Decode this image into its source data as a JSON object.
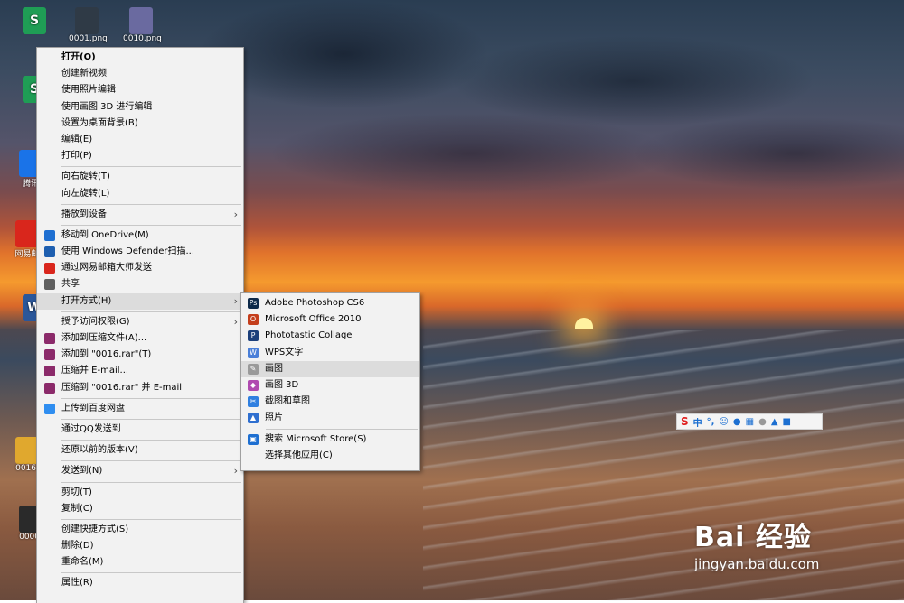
{
  "desktop": {
    "icons": [
      {
        "label": "",
        "glyph": "S",
        "color": "#1f9d55"
      },
      {
        "label": "0001.png",
        "glyph": "",
        "color": "#2f3a46"
      },
      {
        "label": "0010.png",
        "glyph": "",
        "color": "#6a6aa0"
      },
      {
        "label": "",
        "glyph": "S",
        "color": "#1f9d55"
      },
      {
        "label": "腾讯",
        "glyph": "",
        "color": "#1a73e8"
      },
      {
        "label": "网易邮",
        "glyph": "",
        "color": "#d9261c"
      },
      {
        "label": "",
        "glyph": "W",
        "color": "#2b579a"
      },
      {
        "label": "0016.",
        "glyph": "",
        "color": "#e0a82e"
      },
      {
        "label": "0000.",
        "glyph": "",
        "color": "#2a2a2a"
      }
    ]
  },
  "context_menu": {
    "items": [
      {
        "label": "打开(O)",
        "bold": true
      },
      {
        "label": "创建新视频"
      },
      {
        "label": "使用照片编辑"
      },
      {
        "label": "使用画图 3D 进行编辑"
      },
      {
        "label": "设置为桌面背景(B)"
      },
      {
        "label": "编辑(E)"
      },
      {
        "label": "打印(P)"
      },
      {
        "sep": true
      },
      {
        "label": "向右旋转(T)"
      },
      {
        "label": "向左旋转(L)"
      },
      {
        "sep": true
      },
      {
        "label": "播放到设备",
        "arrow": true
      },
      {
        "sep": true
      },
      {
        "label": "移动到 OneDrive(M)",
        "icon": "cloud-icon",
        "iconColor": "#1e6fd1"
      },
      {
        "label": "使用 Windows Defender扫描...",
        "icon": "defender-icon",
        "iconColor": "#1e5fb0"
      },
      {
        "label": "通过网易邮箱大师发送",
        "icon": "netease-mail-icon",
        "iconColor": "#d9261c"
      },
      {
        "label": "共享",
        "icon": "share-icon",
        "iconColor": "#606060"
      },
      {
        "label": "打开方式(H)",
        "arrow": true,
        "highlight": true
      },
      {
        "sep": true
      },
      {
        "label": "授予访问权限(G)",
        "arrow": true
      },
      {
        "label": "添加到压缩文件(A)...",
        "icon": "winrar-icon",
        "iconColor": "#8b2a6a"
      },
      {
        "label": "添加到 \"0016.rar\"(T)",
        "icon": "winrar-icon",
        "iconColor": "#8b2a6a"
      },
      {
        "label": "压缩并 E-mail...",
        "icon": "winrar-icon",
        "iconColor": "#8b2a6a"
      },
      {
        "label": "压缩到 \"0016.rar\" 并 E-mail",
        "icon": "winrar-icon",
        "iconColor": "#8b2a6a"
      },
      {
        "sep": true
      },
      {
        "label": "上传到百度网盘",
        "icon": "baidu-netdisk-icon",
        "iconColor": "#2f8ef0"
      },
      {
        "sep": true
      },
      {
        "label": "通过QQ发送到"
      },
      {
        "sep": true
      },
      {
        "label": "还原以前的版本(V)"
      },
      {
        "sep": true
      },
      {
        "label": "发送到(N)",
        "arrow": true
      },
      {
        "sep": true
      },
      {
        "label": "剪切(T)"
      },
      {
        "label": "复制(C)"
      },
      {
        "sep": true
      },
      {
        "label": "创建快捷方式(S)"
      },
      {
        "label": "删除(D)"
      },
      {
        "label": "重命名(M)"
      },
      {
        "sep": true
      },
      {
        "label": "属性(R)"
      }
    ]
  },
  "open_with_menu": {
    "items": [
      {
        "label": "Adobe Photoshop CS6",
        "icon": "photoshop-icon",
        "iconColor": "#0d2a4a",
        "glyph": "Ps"
      },
      {
        "label": "Microsoft Office 2010",
        "icon": "office-icon",
        "iconColor": "#c43e1c",
        "glyph": "O"
      },
      {
        "label": "Phototastic Collage",
        "icon": "collage-icon",
        "iconColor": "#1c3f7a",
        "glyph": "P"
      },
      {
        "label": "WPS文字",
        "icon": "wps-icon",
        "iconColor": "#4a7fd8",
        "glyph": "W"
      },
      {
        "label": "画图",
        "icon": "paint-icon",
        "iconColor": "#9a9a9a",
        "glyph": "✎",
        "highlight": true
      },
      {
        "label": "画图 3D",
        "icon": "paint3d-icon",
        "iconColor": "#b04ab0",
        "glyph": "◆"
      },
      {
        "label": "截图和草图",
        "icon": "snip-sketch-icon",
        "iconColor": "#2f7fe0",
        "glyph": "✂"
      },
      {
        "label": "照片",
        "icon": "photos-icon",
        "iconColor": "#2f6fd0",
        "glyph": "▲"
      },
      {
        "sep": true
      },
      {
        "label": "搜索 Microsoft Store(S)",
        "icon": "store-icon",
        "iconColor": "#1e6fd1",
        "glyph": "▣"
      },
      {
        "label": "选择其他应用(C)"
      }
    ]
  },
  "ime_toolbar": {
    "logo": "S",
    "mode": "中",
    "punct": "°,"
  },
  "watermark": {
    "brand": "Bai 经验",
    "url": "jingyan.baidu.com"
  }
}
